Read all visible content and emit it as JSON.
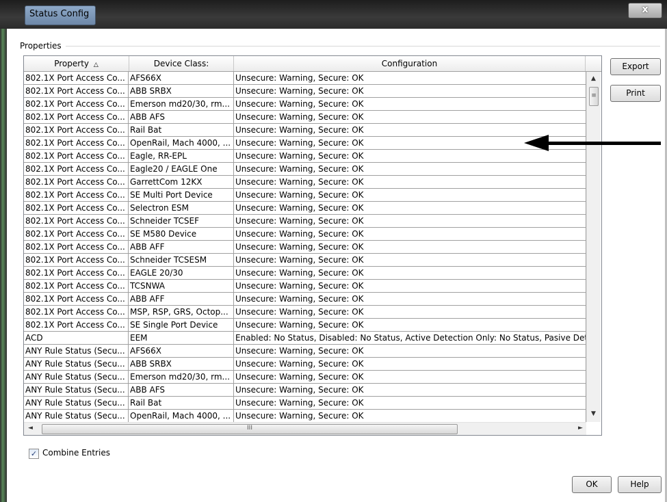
{
  "window": {
    "title": "Status Config",
    "close_glyph": "x"
  },
  "group": {
    "label": "Properties"
  },
  "table": {
    "columns": [
      "Property",
      "Device Class:",
      "Configuration"
    ],
    "sort_glyph": "△",
    "rows": [
      [
        "802.1X Port Access Co...",
        "AFS66X",
        "Unsecure: Warning, Secure: OK"
      ],
      [
        "802.1X Port Access Co...",
        "ABB SRBX",
        "Unsecure: Warning, Secure: OK"
      ],
      [
        "802.1X Port Access Co...",
        "Emerson md20/30, rm...",
        "Unsecure: Warning, Secure: OK"
      ],
      [
        "802.1X Port Access Co...",
        "ABB AFS",
        "Unsecure: Warning, Secure: OK"
      ],
      [
        "802.1X Port Access Co...",
        "Rail Bat",
        "Unsecure: Warning, Secure: OK"
      ],
      [
        "802.1X Port Access Co...",
        "OpenRail, Mach 4000, ...",
        "Unsecure: Warning, Secure: OK"
      ],
      [
        "802.1X Port Access Co...",
        "Eagle, RR-EPL",
        "Unsecure: Warning, Secure: OK"
      ],
      [
        "802.1X Port Access Co...",
        "Eagle20 / EAGLE One",
        "Unsecure: Warning, Secure: OK"
      ],
      [
        "802.1X Port Access Co...",
        "GarrettCom 12KX",
        "Unsecure: Warning, Secure: OK"
      ],
      [
        "802.1X Port Access Co...",
        "SE Multi Port Device",
        "Unsecure: Warning, Secure: OK"
      ],
      [
        "802.1X Port Access Co...",
        "Selectron ESM",
        "Unsecure: Warning, Secure: OK"
      ],
      [
        "802.1X Port Access Co...",
        "Schneider TCSEF",
        "Unsecure: Warning, Secure: OK"
      ],
      [
        "802.1X Port Access Co...",
        "SE M580 Device",
        "Unsecure: Warning, Secure: OK"
      ],
      [
        "802.1X Port Access Co...",
        "ABB AFF",
        "Unsecure: Warning, Secure: OK"
      ],
      [
        "802.1X Port Access Co...",
        "Schneider TCSESM",
        "Unsecure: Warning, Secure: OK"
      ],
      [
        "802.1X Port Access Co...",
        "EAGLE 20/30",
        "Unsecure: Warning, Secure: OK"
      ],
      [
        "802.1X Port Access Co...",
        "TCSNWA",
        "Unsecure: Warning, Secure: OK"
      ],
      [
        "802.1X Port Access Co...",
        "ABB AFF",
        "Unsecure: Warning, Secure: OK"
      ],
      [
        "802.1X Port Access Co...",
        "MSP, RSP, GRS, Octop...",
        "Unsecure: Warning, Secure: OK"
      ],
      [
        "802.1X Port Access Co...",
        "SE Single Port Device",
        "Unsecure: Warning, Secure: OK"
      ],
      [
        "ACD",
        "EEM",
        "Enabled: No Status, Disabled: No Status, Active Detection Only: No Status, Pasive Dete"
      ],
      [
        "ANY Rule Status (Secu...",
        "AFS66X",
        "Unsecure: Warning, Secure: OK"
      ],
      [
        "ANY Rule Status (Secu...",
        "ABB SRBX",
        "Unsecure: Warning, Secure: OK"
      ],
      [
        "ANY Rule Status (Secu...",
        "Emerson md20/30, rm...",
        "Unsecure: Warning, Secure: OK"
      ],
      [
        "ANY Rule Status (Secu...",
        "ABB AFS",
        "Unsecure: Warning, Secure: OK"
      ],
      [
        "ANY Rule Status (Secu...",
        "Rail Bat",
        "Unsecure: Warning, Secure: OK"
      ],
      [
        "ANY Rule Status (Secu...",
        "OpenRail, Mach 4000, ...",
        "Unsecure: Warning, Secure: OK"
      ]
    ]
  },
  "scrollbars": {
    "up": "▲",
    "down": "▼",
    "left": "◄",
    "right": "►",
    "grip_v": "≡",
    "grip_h": "III"
  },
  "buttons": {
    "export": "Export",
    "print": "Print",
    "ok": "OK",
    "help": "Help"
  },
  "checkbox": {
    "label": "Combine Entries",
    "checked": true,
    "mark": "✓"
  },
  "icons": [
    "close-icon",
    "sort-ascending-icon",
    "scroll-up-icon",
    "scroll-down-icon",
    "scroll-left-icon",
    "scroll-right-icon",
    "annotation-arrow-icon"
  ]
}
